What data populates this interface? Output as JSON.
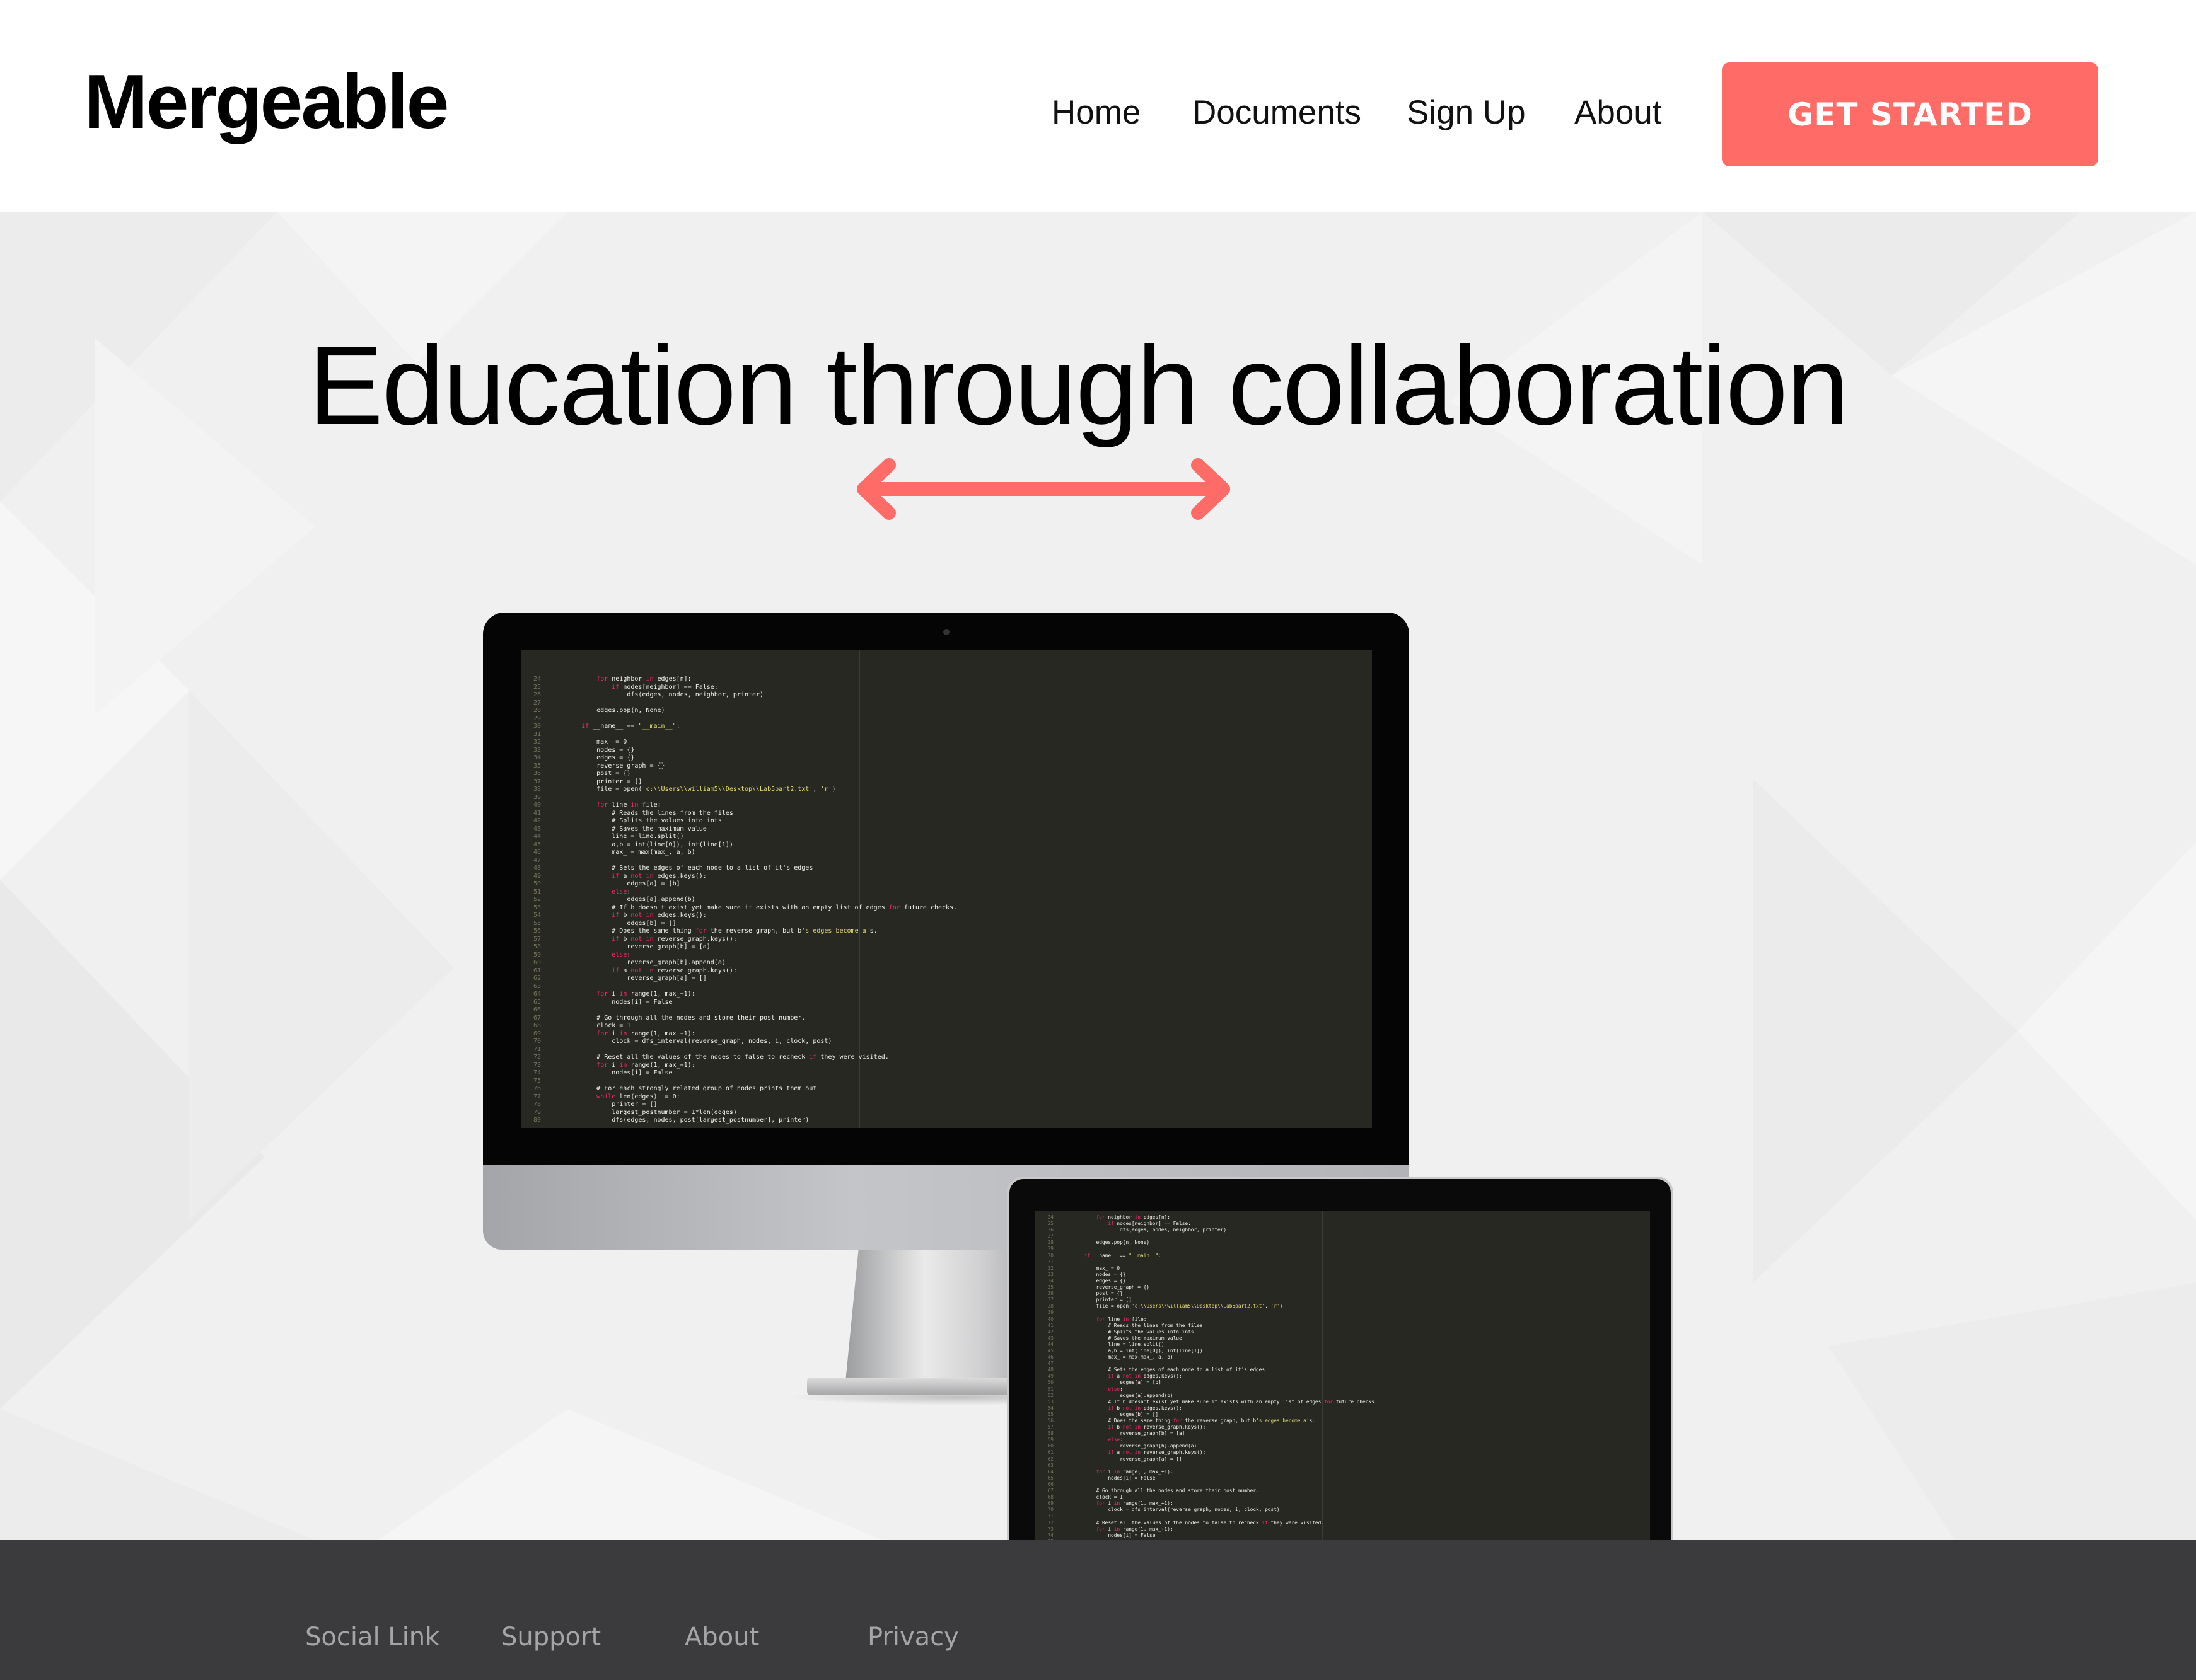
{
  "header": {
    "logo": "Mergeable",
    "nav": [
      "Home",
      "Documents",
      "Sign Up",
      "About"
    ],
    "cta": "GET STARTED"
  },
  "hero": {
    "title": "Education through collaboration"
  },
  "code_lines": [
    {
      "n": "24",
      "t": "        for neighbor in edges[n]:"
    },
    {
      "n": "25",
      "t": "            if nodes[neighbor] == False:"
    },
    {
      "n": "26",
      "t": "                dfs(edges, nodes, neighbor, printer)"
    },
    {
      "n": "27",
      "t": ""
    },
    {
      "n": "28",
      "t": "        edges.pop(n, None)"
    },
    {
      "n": "29",
      "t": ""
    },
    {
      "n": "30",
      "t": "    if __name__ == \"__main__\":"
    },
    {
      "n": "31",
      "t": ""
    },
    {
      "n": "32",
      "t": "        max_ = 0"
    },
    {
      "n": "33",
      "t": "        nodes = {}"
    },
    {
      "n": "34",
      "t": "        edges = {}"
    },
    {
      "n": "35",
      "t": "        reverse_graph = {}"
    },
    {
      "n": "36",
      "t": "        post = {}"
    },
    {
      "n": "37",
      "t": "        printer = []"
    },
    {
      "n": "38",
      "t": "        file = open('c:\\\\Users\\\\william5\\\\Desktop\\\\Lab5part2.txt', 'r')"
    },
    {
      "n": "39",
      "t": ""
    },
    {
      "n": "40",
      "t": "        for line in file:"
    },
    {
      "n": "41",
      "t": "            # Reads the lines from the files"
    },
    {
      "n": "42",
      "t": "            # Splits the values into ints"
    },
    {
      "n": "43",
      "t": "            # Saves the maximum value"
    },
    {
      "n": "44",
      "t": "            line = line.split()"
    },
    {
      "n": "45",
      "t": "            a,b = int(line[0]), int(line[1])"
    },
    {
      "n": "46",
      "t": "            max_ = max(max_, a, b)"
    },
    {
      "n": "47",
      "t": ""
    },
    {
      "n": "48",
      "t": "            # Sets the edges of each node to a list of it's edges"
    },
    {
      "n": "49",
      "t": "            if a not in edges.keys():"
    },
    {
      "n": "50",
      "t": "                edges[a] = [b]"
    },
    {
      "n": "51",
      "t": "            else:"
    },
    {
      "n": "52",
      "t": "                edges[a].append(b)"
    },
    {
      "n": "53",
      "t": "            # If b doesn't exist yet make sure it exists with an empty list of edges for future checks."
    },
    {
      "n": "54",
      "t": "            if b not in edges.keys():"
    },
    {
      "n": "55",
      "t": "                edges[b] = []"
    },
    {
      "n": "56",
      "t": "            # Does the same thing for the reverse graph, but b's edges become a's."
    },
    {
      "n": "57",
      "t": "            if b not in reverse_graph.keys():"
    },
    {
      "n": "58",
      "t": "                reverse_graph[b] = [a]"
    },
    {
      "n": "59",
      "t": "            else:"
    },
    {
      "n": "60",
      "t": "                reverse_graph[b].append(a)"
    },
    {
      "n": "61",
      "t": "            if a not in reverse_graph.keys():"
    },
    {
      "n": "62",
      "t": "                reverse_graph[a] = []"
    },
    {
      "n": "63",
      "t": ""
    },
    {
      "n": "64",
      "t": "        for i in range(1, max_+1):"
    },
    {
      "n": "65",
      "t": "            nodes[i] = False"
    },
    {
      "n": "66",
      "t": ""
    },
    {
      "n": "67",
      "t": "        # Go through all the nodes and store their post number."
    },
    {
      "n": "68",
      "t": "        clock = 1"
    },
    {
      "n": "69",
      "t": "        for i in range(1, max_+1):"
    },
    {
      "n": "70",
      "t": "            clock = dfs_interval(reverse_graph, nodes, i, clock, post)"
    },
    {
      "n": "71",
      "t": ""
    },
    {
      "n": "72",
      "t": "        # Reset all the values of the nodes to false to recheck if they were visited."
    },
    {
      "n": "73",
      "t": "        for i in range(1, max_+1):"
    },
    {
      "n": "74",
      "t": "            nodes[i] = False"
    },
    {
      "n": "75",
      "t": ""
    },
    {
      "n": "76",
      "t": "        # For each strongly related group of nodes prints them out"
    },
    {
      "n": "77",
      "t": "        while len(edges) != 0:"
    },
    {
      "n": "78",
      "t": "            printer = []"
    },
    {
      "n": "79",
      "t": "            largest_postnumber = 1*len(edges)"
    },
    {
      "n": "80",
      "t": "            dfs(edges, nodes, post[largest_postnumber], printer)"
    }
  ],
  "footer": {
    "links": [
      "Social Link",
      "Support",
      "About",
      "Privacy"
    ]
  },
  "colors": {
    "accent": "#ff6b66",
    "footer_bg": "#3b3b3d",
    "hero_bg": "#f0f0f0",
    "editor_bg": "#272822"
  },
  "icons": {
    "hero_arrow": "double-headed-arrow-icon"
  }
}
